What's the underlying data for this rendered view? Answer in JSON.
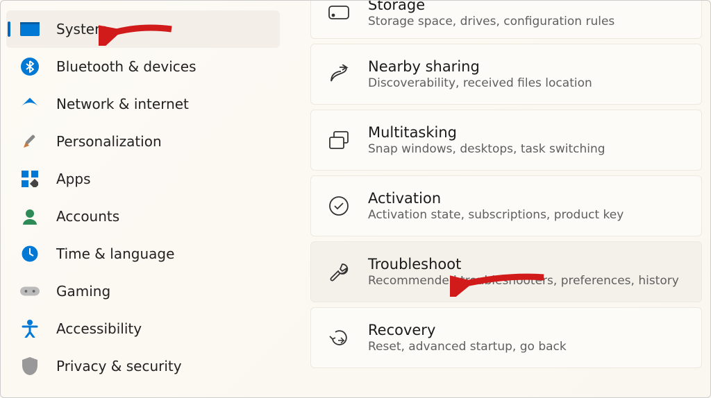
{
  "sidebar": {
    "items": [
      {
        "label": "System",
        "selected": true
      },
      {
        "label": "Bluetooth & devices",
        "selected": false
      },
      {
        "label": "Network & internet",
        "selected": false
      },
      {
        "label": "Personalization",
        "selected": false
      },
      {
        "label": "Apps",
        "selected": false
      },
      {
        "label": "Accounts",
        "selected": false
      },
      {
        "label": "Time & language",
        "selected": false
      },
      {
        "label": "Gaming",
        "selected": false
      },
      {
        "label": "Accessibility",
        "selected": false
      },
      {
        "label": "Privacy & security",
        "selected": false
      }
    ]
  },
  "content": {
    "cards": [
      {
        "title": "Storage",
        "desc": "Storage space, drives, configuration rules"
      },
      {
        "title": "Nearby sharing",
        "desc": "Discoverability, received files location"
      },
      {
        "title": "Multitasking",
        "desc": "Snap windows, desktops, task switching"
      },
      {
        "title": "Activation",
        "desc": "Activation state, subscriptions, product key"
      },
      {
        "title": "Troubleshoot",
        "desc": "Recommended troubleshooters, preferences, history",
        "highlight": true
      },
      {
        "title": "Recovery",
        "desc": "Reset, advanced startup, go back"
      }
    ]
  },
  "annotations": {
    "arrow_color": "#d11a1a"
  }
}
